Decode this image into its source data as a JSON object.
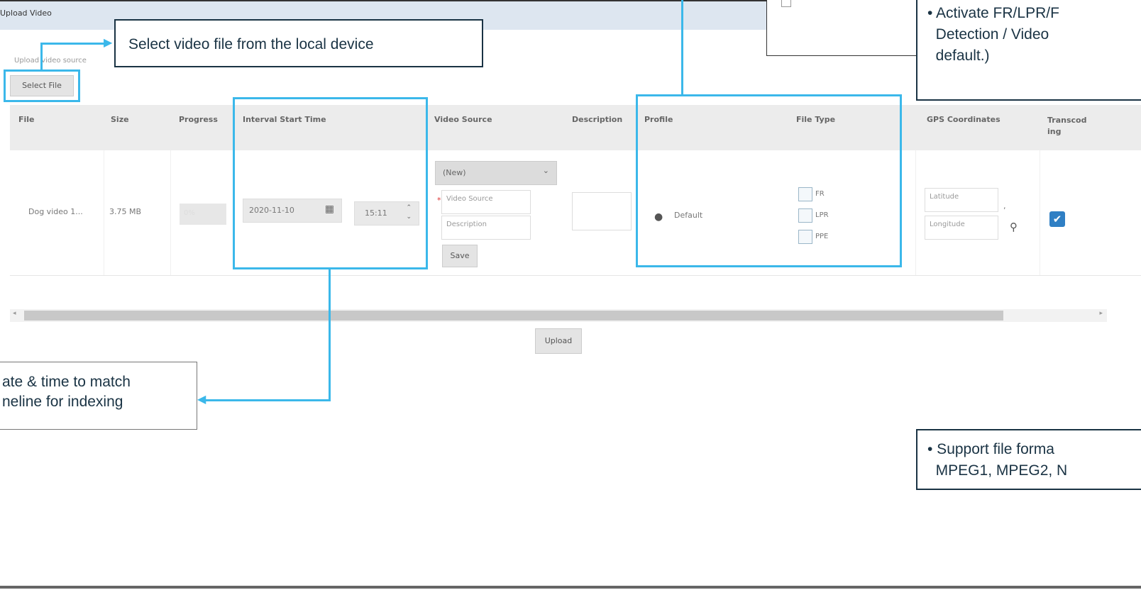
{
  "window": {
    "title": "Upload Video"
  },
  "upload": {
    "source_line": "Upload video source",
    "select_file_label": "Select File",
    "upload_label": "Upload"
  },
  "table": {
    "headers": {
      "file": "File",
      "size": "Size",
      "progress": "Progress",
      "interval": "Interval Start Time",
      "video_source": "Video Source",
      "description": "Description",
      "profile": "Profile",
      "file_type": "File Type",
      "gps": "GPS Coordinates",
      "transcoding": "Transcod ing"
    },
    "row": {
      "file_name": "Dog video 1...",
      "size": "3.75 MB",
      "progress": "0%",
      "date": "2020-11-10",
      "time": "15:11",
      "video_source_select": "(New)",
      "video_source_placeholder": "Video Source",
      "description_placeholder": "Description",
      "save_label": "Save",
      "profile": "Default",
      "file_types": [
        "FR",
        "LPR",
        "PPE"
      ],
      "latitude_placeholder": "Latitude",
      "longitude_placeholder": "Longitude",
      "comma": ",",
      "transcoding_checked": true
    }
  },
  "callouts": {
    "select_file": "Select video file from the local device",
    "date_time": "ate & time to match\nneline for indexing",
    "activate": "• Activate FR/LPR/F\n  Detection / Video\n  default.)",
    "formats": "• Support file forma\n  MPEG1, MPEG2, N"
  },
  "colors": {
    "accent": "#3bb8ea",
    "callout_border": "#1a3344",
    "checkbox_checked": "#2f7fc4"
  }
}
